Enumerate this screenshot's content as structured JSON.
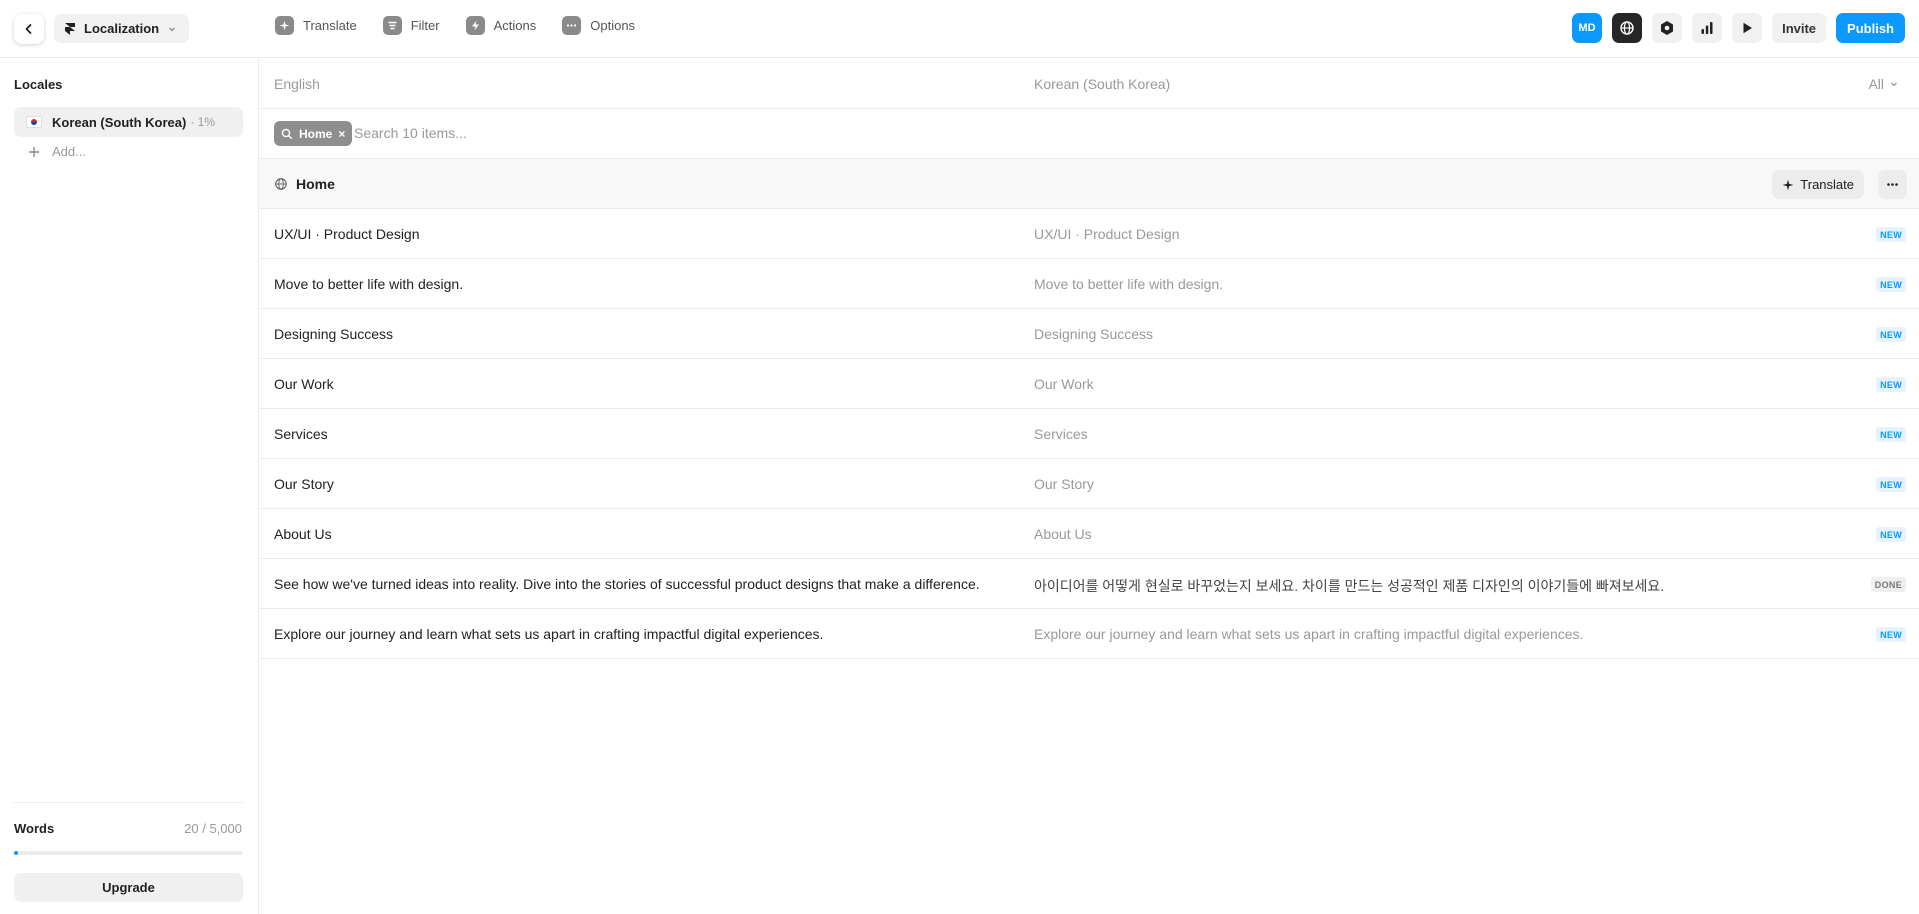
{
  "header": {
    "project_name": "Localization",
    "tools": [
      {
        "label": "Translate",
        "icon": "sparkle-icon"
      },
      {
        "label": "Filter",
        "icon": "filter-icon"
      },
      {
        "label": "Actions",
        "icon": "bolt-icon"
      },
      {
        "label": "Options",
        "icon": "dots-icon"
      }
    ],
    "avatar_initials": "MD",
    "invite_label": "Invite",
    "publish_label": "Publish"
  },
  "sidebar": {
    "title": "Locales",
    "locales": [
      {
        "name": "Korean (South Korea)",
        "progress": "· 1%"
      }
    ],
    "add_label": "Add...",
    "words_label": "Words",
    "words_count": "20 / 5,000",
    "words_fraction": 0.004,
    "upgrade_label": "Upgrade"
  },
  "main": {
    "source_lang": "English",
    "target_lang": "Korean (South Korea)",
    "status_filter": "All",
    "filter_chip": "Home",
    "search_placeholder": "Search 10 items...",
    "group_title": "Home",
    "translate_label": "Translate",
    "rows": [
      {
        "source": "UX/UI · Product Design",
        "target": "UX/UI ·  Product Design",
        "status": "NEW"
      },
      {
        "source": "Move to better life with design.",
        "target": "Move to better life with design.",
        "status": "NEW"
      },
      {
        "source": "Designing Success",
        "target": "Designing Success",
        "status": "NEW"
      },
      {
        "source": "Our Work",
        "target": "Our Work",
        "status": "NEW"
      },
      {
        "source": "Services",
        "target": "Services",
        "status": "NEW"
      },
      {
        "source": "Our Story",
        "target": "Our Story",
        "status": "NEW"
      },
      {
        "source": "About Us",
        "target": "About Us",
        "status": "NEW"
      },
      {
        "source": "See how we've turned ideas into reality. Dive into the stories of successful product designs that make a difference.",
        "target": "아이디어를 어떻게 현실로 바꾸었는지 보세요. 차이를 만드는 성공적인 제품 디자인의 이야기들에 빠져보세요.",
        "status": "DONE"
      },
      {
        "source": "Explore our journey and learn what sets us apart in crafting impactful digital experiences.",
        "target": "Explore our journey and learn what sets us apart in crafting impactful digital experiences.",
        "status": "NEW"
      }
    ]
  },
  "colors": {
    "accent": "#0b99ff",
    "border": "#ececec"
  }
}
